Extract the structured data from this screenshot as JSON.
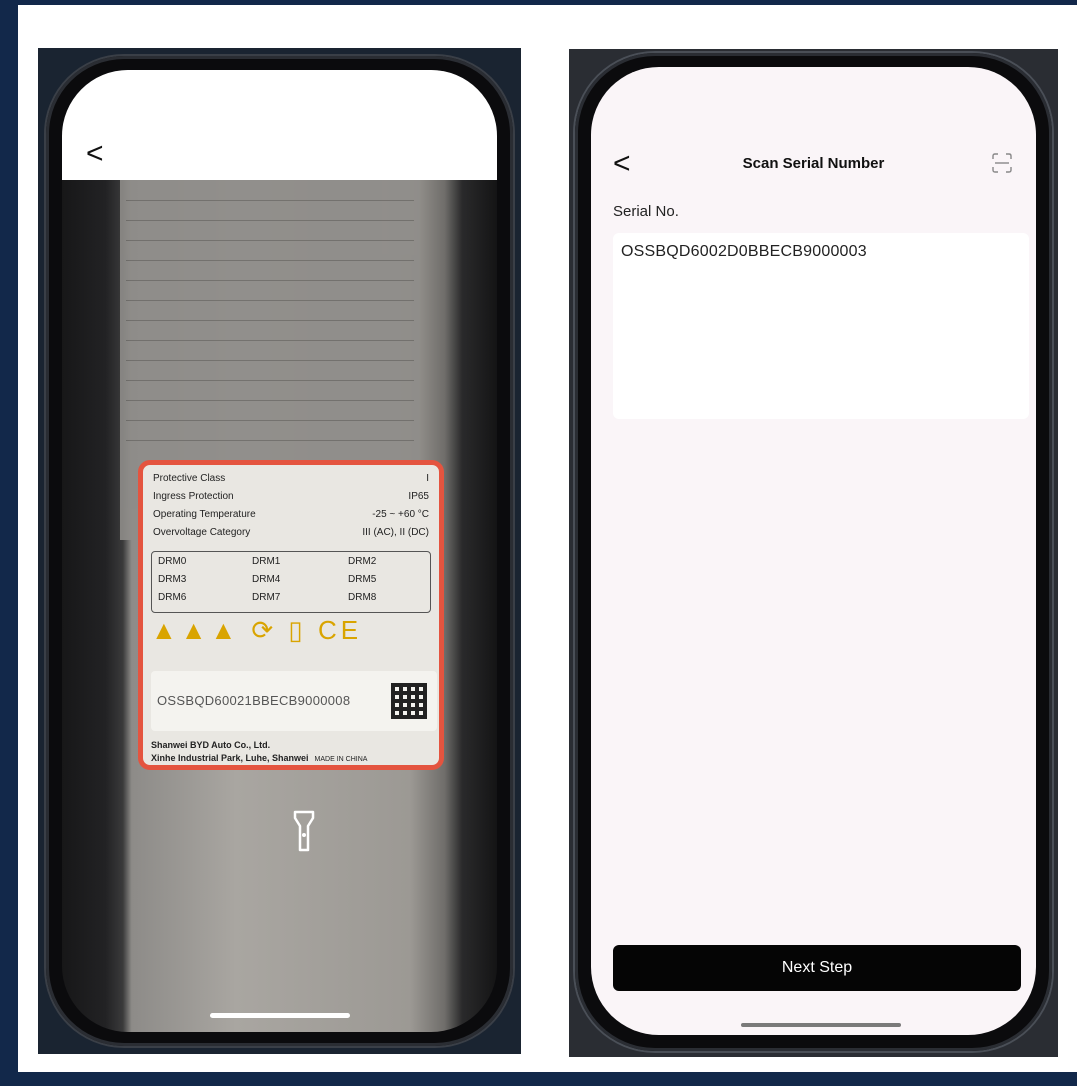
{
  "left_screen": {
    "back_glyph": "<",
    "label_lines": [
      {
        "name": "Protective Class",
        "value": "I"
      },
      {
        "name": "Ingress Protection",
        "value": "IP65"
      },
      {
        "name": "Operating Temperature",
        "value": "-25 ~ +60 °C"
      },
      {
        "name": "Overvoltage Category",
        "value": "III (AC), II (DC)"
      }
    ],
    "drm": [
      "DRM0",
      "DRM1",
      "DRM2",
      "DRM3",
      "DRM4",
      "DRM5",
      "DRM6",
      "DRM7",
      "DRM8"
    ],
    "ocr_serial": "OSSBQD60021BBECB9000008",
    "maker_line1": "Shanwei BYD Auto Co., Ltd.",
    "maker_line2": "Xinhe Industrial Park, Luhe, Shanwei",
    "made_in": "MADE IN CHINA",
    "flashlight_icon": "flashlight-icon"
  },
  "right_screen": {
    "back_glyph": "<",
    "title": "Scan Serial Number",
    "scan_icon": "scan-icon",
    "field_label": "Serial No.",
    "serial_value": "OSSBQD6002D0BBECB9000003",
    "next_label": "Next Step"
  },
  "colors": {
    "frame": "#12284a",
    "scan_box_border": "#e4543f",
    "button_bg": "#050505",
    "screen_bg": "#faf5f8"
  }
}
